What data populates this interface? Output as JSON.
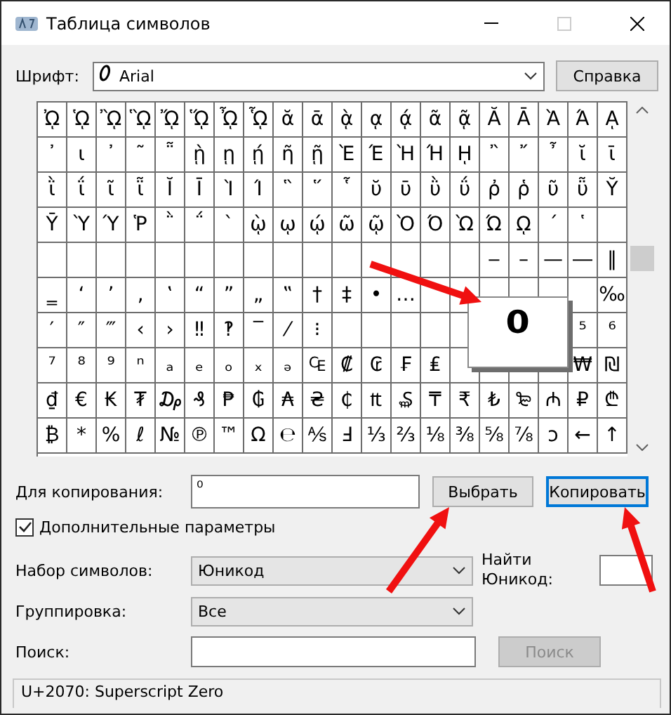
{
  "window": {
    "title": "Таблица символов"
  },
  "font": {
    "label": "Шрифт:",
    "value": "Arial"
  },
  "help_button": "Справка",
  "grid": {
    "rows": [
      [
        "ᾨ",
        "ᾩ",
        "ᾪ",
        "ᾫ",
        "ᾬ",
        "ᾭ",
        "ᾮ",
        "ᾯ",
        "ᾰ",
        "ᾱ",
        "ᾲ",
        "ᾳ",
        "ᾴ",
        "ᾶ",
        "ᾷ",
        "Ᾰ",
        "Ᾱ",
        "Ὰ",
        "Ά",
        "ᾼ"
      ],
      [
        "᾽",
        "ι",
        "᾿",
        "῀",
        "῁",
        "ῂ",
        "ῃ",
        "ῄ",
        "ῆ",
        "ῇ",
        "Ὲ",
        "Έ",
        "Ὴ",
        "Ή",
        "ῌ",
        "῍",
        "῎",
        "῏",
        "ῐ",
        "ῑ"
      ],
      [
        "ῒ",
        "ΐ",
        "ῖ",
        "ῗ",
        "Ῐ",
        "Ῑ",
        "Ὶ",
        "Ί",
        "῝",
        "῞",
        "῟",
        "ῠ",
        "ῡ",
        "ῢ",
        "ΰ",
        "ῤ",
        "ῥ",
        "ῦ",
        "ῧ",
        "Ῠ"
      ],
      [
        "Ῡ",
        "Ὺ",
        "Ύ",
        "Ῥ",
        "῭",
        "΅",
        "`",
        "ῲ",
        "ῳ",
        "ῴ",
        "ῶ",
        "ῷ",
        "Ὸ",
        "Ό",
        "Ὼ",
        "Ώ",
        "ῼ",
        "´",
        "῾",
        null
      ],
      [
        null,
        null,
        null,
        null,
        null,
        null,
        null,
        null,
        null,
        null,
        null,
        null,
        null,
        null,
        null,
        "‒",
        "–",
        "—",
        "―",
        "‖"
      ],
      [
        "‗",
        "‘",
        "’",
        "‚",
        "‛",
        "“",
        "”",
        "„",
        "‟",
        "†",
        "‡",
        "•",
        "…",
        null,
        null,
        null,
        null,
        null,
        null,
        "‰"
      ],
      [
        "′",
        "″",
        "‴",
        "‹",
        "›",
        "‼",
        "‽",
        "‾",
        "⁄",
        "⁝",
        null,
        null,
        null,
        null,
        null,
        null,
        null,
        null,
        "⁵",
        "⁶"
      ],
      [
        "⁷",
        "⁸",
        "⁹",
        "ⁿ",
        "ₐ",
        "ₑ",
        "ₒ",
        "ₓ",
        "ₔ",
        "₠",
        "₡",
        "₢",
        "₣",
        "₤",
        null,
        null,
        null,
        null,
        "₩",
        "₪"
      ],
      [
        "₫",
        "€",
        "₭",
        "₮",
        "₯",
        "₰",
        "₱",
        "₲",
        "₳",
        "₴",
        "₵",
        "₶",
        "₷",
        "₸",
        "₹",
        "₺",
        "₻",
        "₼",
        "₽",
        "₾"
      ],
      [
        "₿",
        "*",
        "%",
        "ℓ",
        "№",
        "℗",
        "™",
        "Ω",
        "℮",
        "⅍",
        "Ⅎ",
        "⅓",
        "⅔",
        "⅛",
        "⅜",
        "⅝",
        "⅞",
        "ↄ",
        "←",
        "↑"
      ]
    ]
  },
  "magnifier": {
    "char": "⁰"
  },
  "copy": {
    "label": "Для копирования:",
    "value": "⁰"
  },
  "select_button": "Выбрать",
  "copy_button": "Копировать",
  "advanced": {
    "label": "Дополнительные параметры",
    "checked": true
  },
  "charset": {
    "label": "Набор символов:",
    "value": "Юникод"
  },
  "find_unicode": {
    "label": "Найти Юникод:"
  },
  "grouping": {
    "label": "Группировка:",
    "value": "Все"
  },
  "search": {
    "label": "Поиск:",
    "button": "Поиск",
    "disabled": true
  },
  "status": "U+2070: Superscript Zero"
}
